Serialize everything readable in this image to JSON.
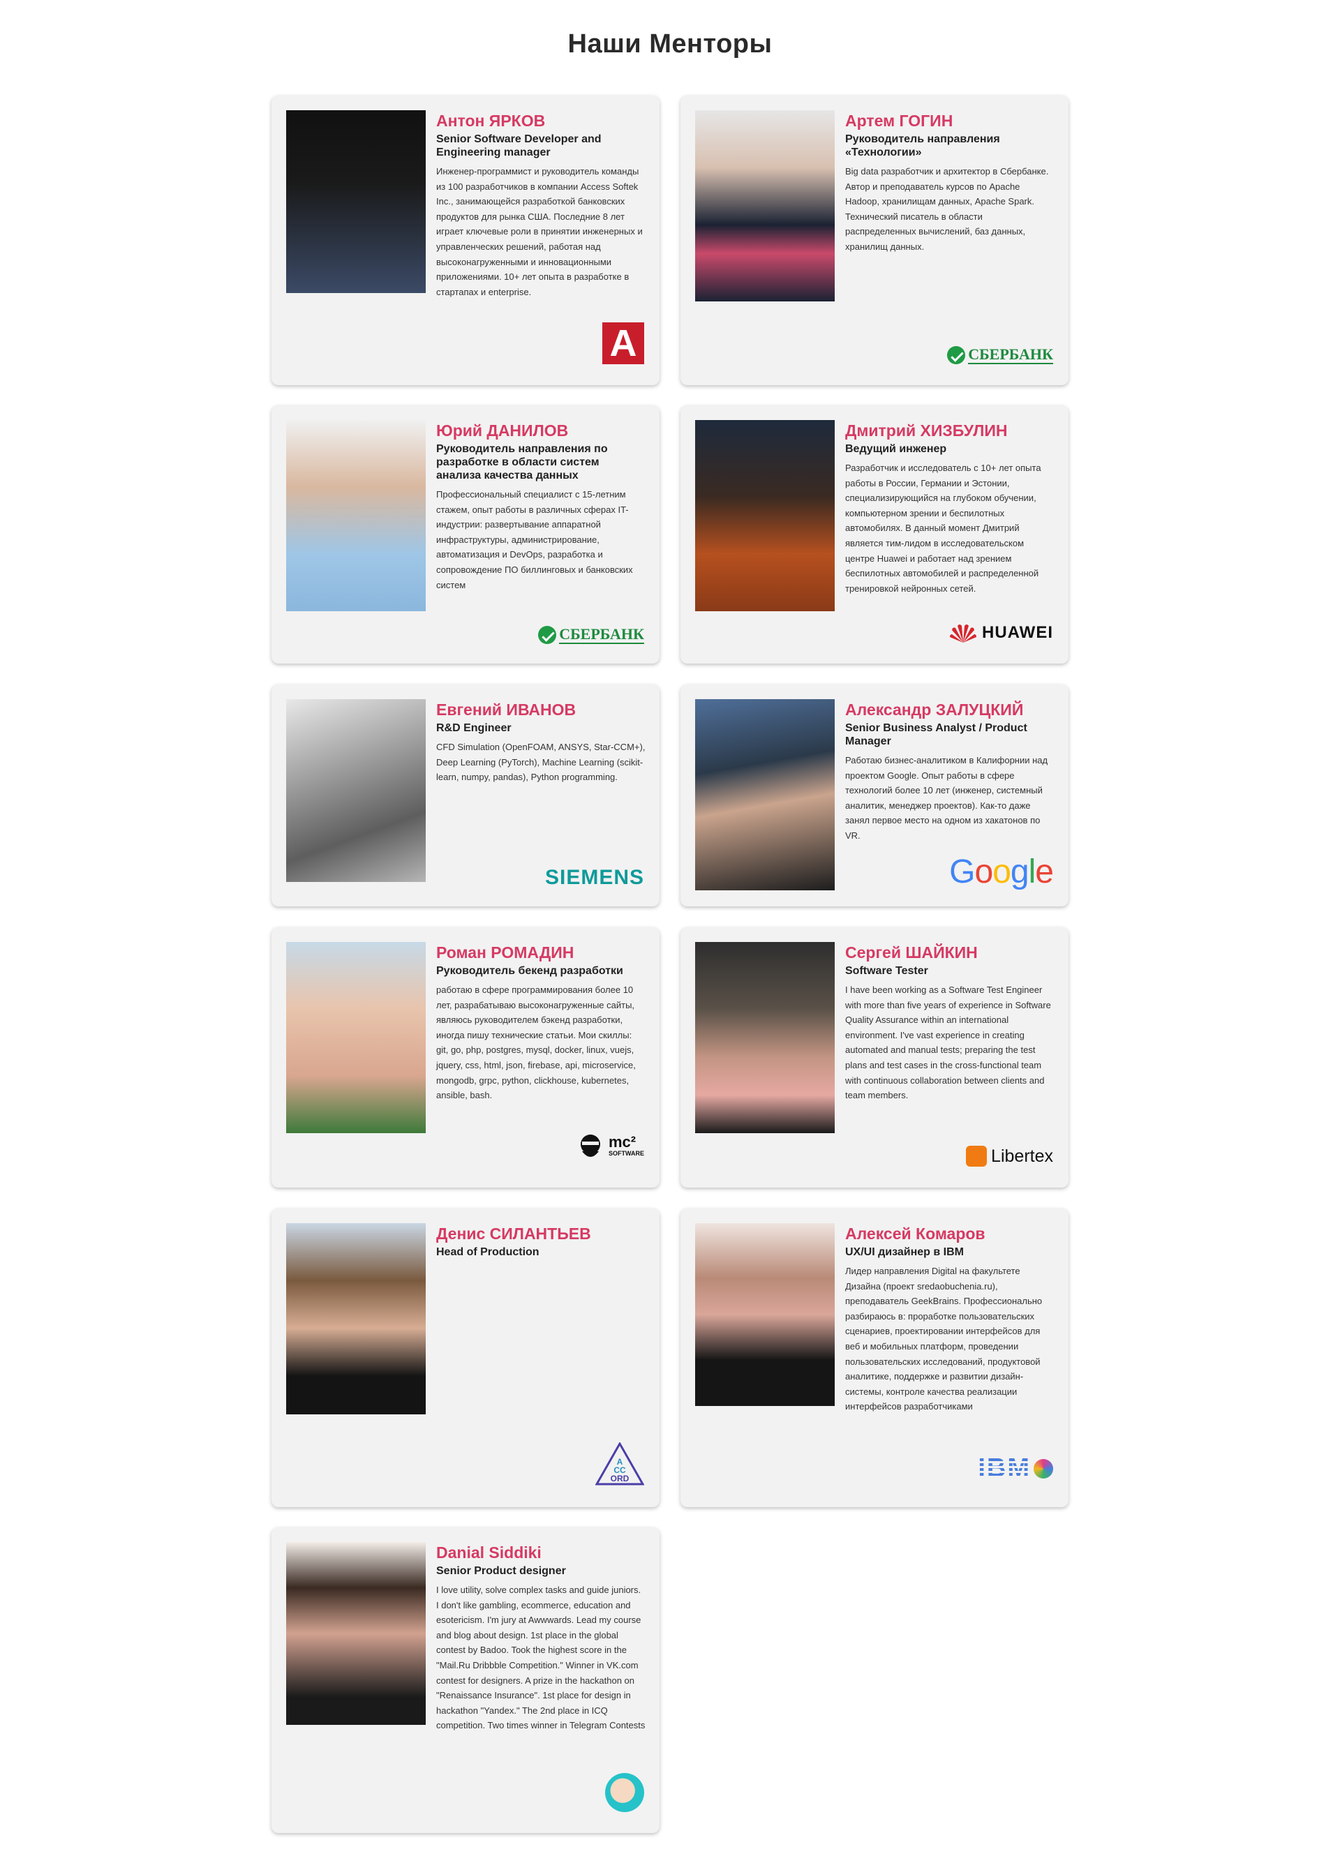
{
  "page": {
    "title": "Наши Менторы"
  },
  "mentors": [
    {
      "name": "Антон ЯРКОВ",
      "role": "Senior Software Developer and Engineering manager",
      "bio": "Инженер-программист и руководитель команды из 100 разработчиков в компании Access Softek Inc., занимающейся разработкой банковских продуктов для рынка США. Последние 8 лет играет ключевые роли в принятии инженерных и управленческих решений, работая над высоконагруженными и инновационными приложениями. 10+ лет опыта в разработке в стартапах и enterprise.",
      "logo": {
        "icon": "access-softek-logo",
        "text": "A",
        "color": "#c81e2c"
      }
    },
    {
      "name": "Артем ГОГИН",
      "role": "Руководитель направления «Технологии»",
      "bio": "Big data разработчик и архитектор в Сбербанке. Автор и преподаватель курсов по Apache Hadoop, хранилищам данных, Apache Spark. Технический писатель в области распределенных вычислений, баз данных, хранилищ данных.",
      "logo": {
        "icon": "sberbank-logo",
        "text": "СБЕРБАНК",
        "color": "#1f8a3f"
      }
    },
    {
      "name": "Юрий ДАНИЛОВ",
      "role": "Руководитель направления по разработке в области систем анализа качества данных",
      "bio": "Профессиональный специалист с 15-летним стажем, опыт работы в различных сферах IT-индустрии: развертывание аппаратной инфраструктуры, администрирование, автоматизация и DevOps, разработка и сопровождение ПО биллинговых и банковских систем",
      "logo": {
        "icon": "sberbank-logo",
        "text": "СБЕРБАНК",
        "color": "#1f8a3f"
      }
    },
    {
      "name": "Дмитрий ХИЗБУЛИН",
      "role": "Ведущий инженер",
      "bio": "Разработчик и исследователь с 10+ лет опыта работы в России, Германии и Эстонии, специализирующийся на глубоком обучении, компьютерном зрении и беспилотных автомобилях. В данный момент Дмитрий является тим-лидом в исследовательском центре Huawei и работает над зрением беспилотных автомобилей и распределенной тренировкой нейронных сетей.",
      "logo": {
        "icon": "huawei-logo",
        "text": "HUAWEI",
        "color": "#d7262d"
      }
    },
    {
      "name": "Евгений ИВАНОВ",
      "role": "R&D Engineer",
      "bio": "CFD Simulation (OpenFOAM, ANSYS, Star-CCM+), Deep Learning (PyTorch), Machine Learning (scikit-learn, numpy, pandas), Python programming.",
      "logo": {
        "icon": "siemens-logo",
        "text": "SIEMENS",
        "color": "#0f9a9a"
      }
    },
    {
      "name": "Александр ЗАЛУЦКИЙ",
      "role": "Senior Business Analyst / Product Manager",
      "bio": "Работаю бизнес-аналитиком в Калифорнии над проектом Google. Опыт работы в сфере технологий более 10 лет (инженер, системный аналитик, менеджер проектов). Как-то даже занял первое место на одном из хакатонов по VR.",
      "logo": {
        "icon": "google-logo",
        "text": "Google",
        "color": "#4285f4"
      }
    },
    {
      "name": "Роман РОМАДИН",
      "role": "Руководитель бекенд разработки",
      "bio": "работаю в сфере программирования более 10 лет, разрабатываю высоконагруженные сайты, являюсь руководителем бэкенд разработки, иногда пишу технические статьи. Мои скиллы: git, go, php, postgres, mysql, docker, linux, vuejs, jquery, css, html, json, firebase, api, microservice, mongodb, grpc, python, clickhouse, kubernetes, ansible, bash.",
      "logo": {
        "icon": "mc2-software-logo",
        "text": "mc²",
        "sub": "SOFTWARE",
        "color": "#111111"
      }
    },
    {
      "name": "Сергей ШАЙКИН",
      "role": "Software Tester",
      "bio": "I have been working as a Software Test Engineer with more than five years of experience in Software Quality Assurance within an international environment. I've vast experience in creating automated and manual tests; preparing the test plans and test cases in the cross-functional team with continuous collaboration between clients and team members.",
      "logo": {
        "icon": "libertex-logo",
        "text": "Libertex",
        "color": "#f07b12"
      }
    },
    {
      "name": "Денис СИЛАНТЬЕВ",
      "role": "Head of Production",
      "bio": "",
      "logo": {
        "icon": "accord-logo",
        "text": "ACCORD",
        "color": "#4b3fa8"
      }
    },
    {
      "name": "Алексей Комаров",
      "role": "UX/UI дизайнер в IBM",
      "bio": "Лидер направления Digital на факультете Дизайна (проект sredaobuchenia.ru), преподаватель GeekBrains. Профессионально разбираюсь в: проработке пользовательских сценариев, проектировании интерфейсов для веб и мобильных платформ, проведении пользовательских исследований, продуктовой аналитике, поддержке и развитии дизайн-системы, контроле качества реализации интерфейсов разработчиками",
      "logo": {
        "icon": "ibm-logo",
        "text": "IBM",
        "color": "#4a7ddb"
      }
    },
    {
      "name": "Danial Siddiki",
      "role": "Senior Product designer",
      "bio": "I love utility, solve complex tasks and guide juniors. I don't like gambling, ecommerce, education and esotericism. I'm jury at Awwwards. Lead my course and blog about design. 1st place in the global contest by Badoo. Took the highest score in the \"Mail.Ru Dribbble Competition.\" Winner in VK.com contest for designers. A prize in the hackathon on \"Renaissance Insurance\". 1st place for design in hackathon \"Yandex.\" The 2nd place in ICQ competition. Two times winner in Telegram Contests",
      "logo": {
        "icon": "designer-avatar-logo",
        "text": "",
        "color": "#26c2c9"
      }
    }
  ]
}
